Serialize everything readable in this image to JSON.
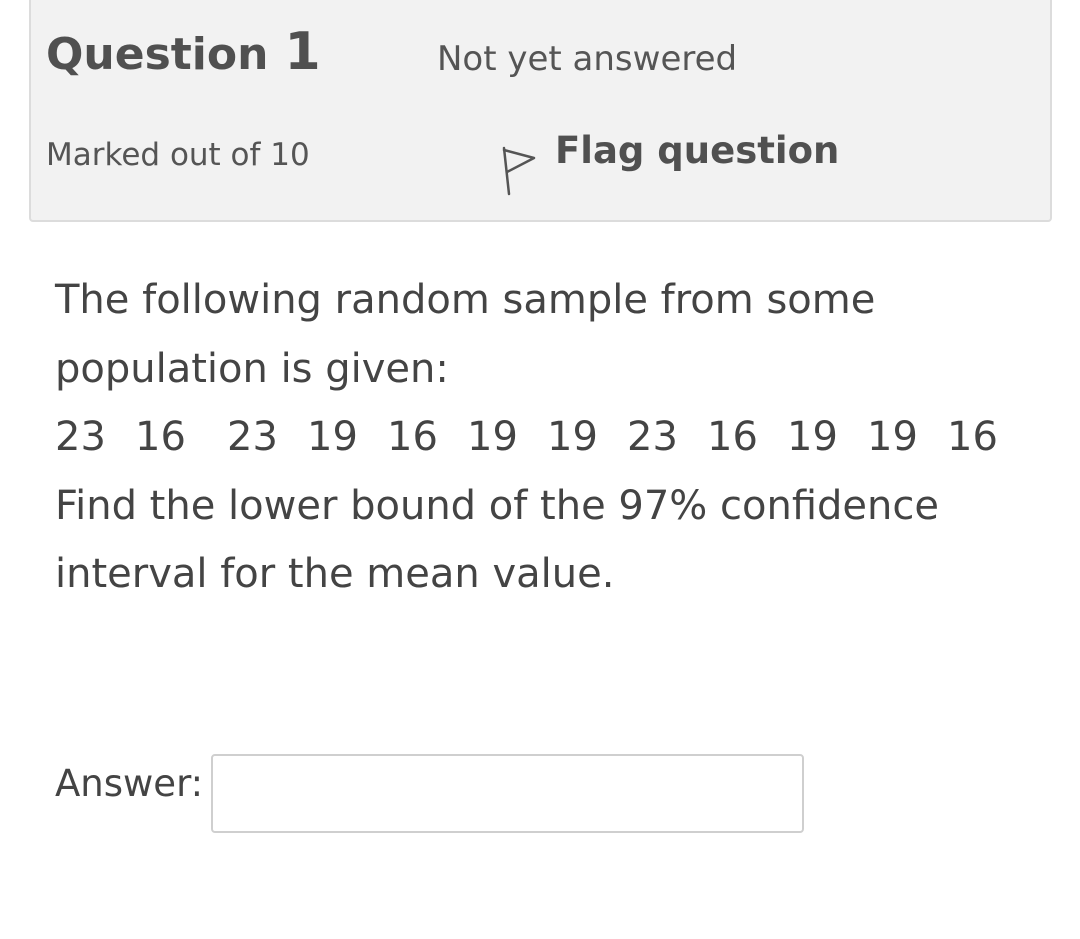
{
  "question_info": {
    "title_word": "Question",
    "number": "1",
    "state": "Not yet answered",
    "grade": "Marked out of 10",
    "flag_label": "Flag question",
    "flag_icon": "flag-outline-icon"
  },
  "question_text": {
    "line1": "The following random sample from some",
    "line2": "population is given:",
    "sample_values": [
      "23",
      "16",
      "23",
      "19",
      "16",
      "19",
      "19",
      "23",
      "16",
      "19",
      "19",
      "16"
    ],
    "line4": "Find the lower bound of the 97% confidence",
    "line5": "interval for the mean value."
  },
  "answer": {
    "label": "Answer:",
    "value": ""
  }
}
